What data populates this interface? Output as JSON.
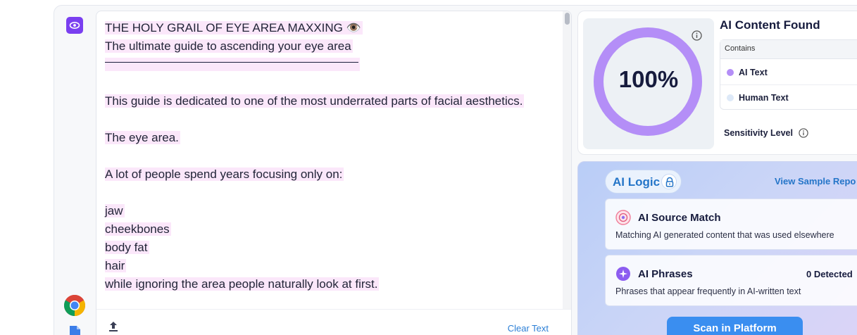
{
  "editor": {
    "lines": [
      {
        "text": "THE HOLY GRAIL OF EYE AREA MAXXING 👁️",
        "hl": true
      },
      {
        "text": "The ultimate guide to ascending your eye area",
        "hl": true
      },
      {
        "text": "",
        "hl": true,
        "rule": true
      },
      {
        "text": "",
        "hl": false
      },
      {
        "text": "This guide is dedicated to one of the most underrated parts of facial aesthetics.",
        "hl": true
      },
      {
        "text": "",
        "hl": false
      },
      {
        "text": "The eye area.",
        "hl": true
      },
      {
        "text": "",
        "hl": false
      },
      {
        "text": "A lot of people spend years focusing only on:",
        "hl": true
      },
      {
        "text": "",
        "hl": false
      },
      {
        "text": "jaw",
        "hl": true
      },
      {
        "text": "cheekbones",
        "hl": true
      },
      {
        "text": "body fat",
        "hl": true
      },
      {
        "text": "hair",
        "hl": true
      },
      {
        "text": "while ignoring the area people naturally look at first.",
        "hl": true
      }
    ],
    "clear_label": "Clear Text"
  },
  "result": {
    "percent": "100%",
    "percent_value": 100,
    "title": "AI Content Found",
    "contains_label": "Contains",
    "rows": [
      {
        "label": "AI Text",
        "color": "#b48ef7"
      },
      {
        "label": "Human Text",
        "color": "#dde9f8"
      }
    ],
    "sensitivity_label": "Sensitivity Level"
  },
  "logic": {
    "pill_label": "AI Logic",
    "view_sample": "View Sample Repo",
    "features": [
      {
        "title": "AI Source Match",
        "desc": "Matching AI generated content that was used elsewhere",
        "badge": ""
      },
      {
        "title": "AI Phrases",
        "desc": "Phrases that appear frequently in AI-written text",
        "badge": "0 Detected"
      }
    ],
    "scan_label": "Scan in Platform"
  },
  "colors": {
    "accent": "#7a3ff0",
    "donut": "#b48ef7",
    "link": "#2475c8",
    "highlight": "#fbe7fa",
    "scan": "#3a8ef0"
  }
}
